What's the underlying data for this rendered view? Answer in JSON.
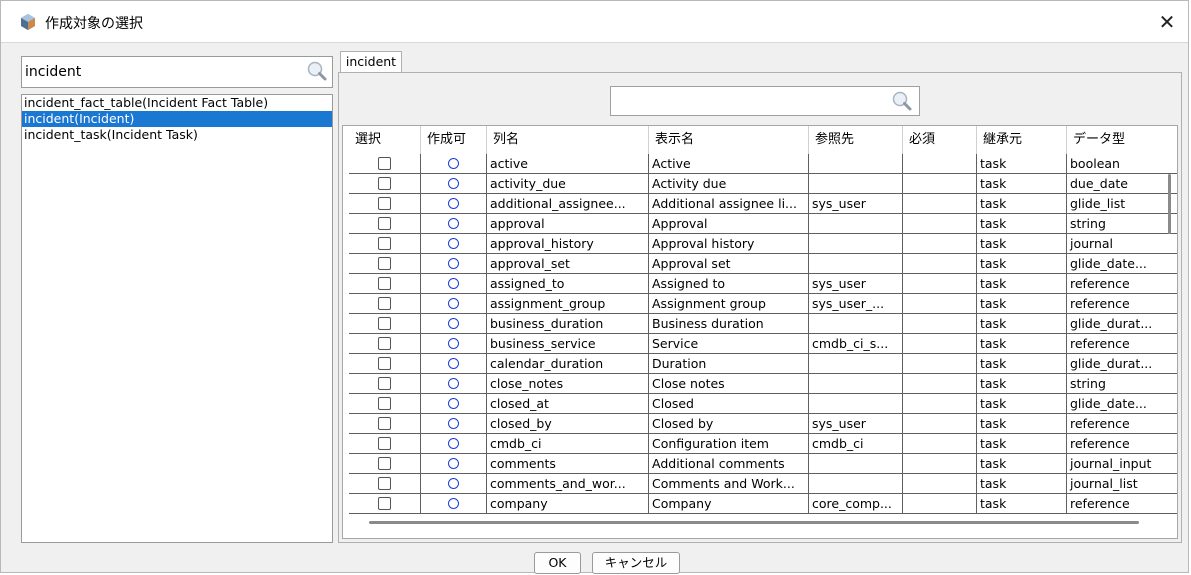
{
  "window": {
    "title": "作成対象の選択"
  },
  "left": {
    "search_value": "incident",
    "items": [
      {
        "label": "incident_fact_table(Incident Fact Table)",
        "selected": false
      },
      {
        "label": "incident(Incident)",
        "selected": true
      },
      {
        "label": "incident_task(Incident Task)",
        "selected": false
      }
    ]
  },
  "tab": {
    "label": "incident"
  },
  "filter": {
    "value": ""
  },
  "table": {
    "headers": [
      "選択",
      "作成可",
      "列名",
      "表示名",
      "参照先",
      "必須",
      "継承元",
      "データ型"
    ],
    "rows": [
      {
        "col": "active",
        "display": "Active",
        "ref": "",
        "inherit": "task",
        "type": "boolean"
      },
      {
        "col": "activity_due",
        "display": "Activity due",
        "ref": "",
        "inherit": "task",
        "type": "due_date"
      },
      {
        "col": "additional_assignee...",
        "display": "Additional assignee li...",
        "ref": "sys_user",
        "inherit": "task",
        "type": "glide_list"
      },
      {
        "col": "approval",
        "display": "Approval",
        "ref": "",
        "inherit": "task",
        "type": "string"
      },
      {
        "col": "approval_history",
        "display": "Approval history",
        "ref": "",
        "inherit": "task",
        "type": "journal"
      },
      {
        "col": "approval_set",
        "display": "Approval set",
        "ref": "",
        "inherit": "task",
        "type": "glide_date..."
      },
      {
        "col": "assigned_to",
        "display": "Assigned to",
        "ref": "sys_user",
        "inherit": "task",
        "type": "reference"
      },
      {
        "col": "assignment_group",
        "display": "Assignment group",
        "ref": "sys_user_...",
        "inherit": "task",
        "type": "reference"
      },
      {
        "col": "business_duration",
        "display": "Business duration",
        "ref": "",
        "inherit": "task",
        "type": "glide_durat..."
      },
      {
        "col": "business_service",
        "display": "Service",
        "ref": "cmdb_ci_s...",
        "inherit": "task",
        "type": "reference"
      },
      {
        "col": "calendar_duration",
        "display": "Duration",
        "ref": "",
        "inherit": "task",
        "type": "glide_durat..."
      },
      {
        "col": "close_notes",
        "display": "Close notes",
        "ref": "",
        "inherit": "task",
        "type": "string"
      },
      {
        "col": "closed_at",
        "display": "Closed",
        "ref": "",
        "inherit": "task",
        "type": "glide_date..."
      },
      {
        "col": "closed_by",
        "display": "Closed by",
        "ref": "sys_user",
        "inherit": "task",
        "type": "reference"
      },
      {
        "col": "cmdb_ci",
        "display": "Configuration item",
        "ref": "cmdb_ci",
        "inherit": "task",
        "type": "reference"
      },
      {
        "col": "comments",
        "display": "Additional comments",
        "ref": "",
        "inherit": "task",
        "type": "journal_input"
      },
      {
        "col": "comments_and_wor...",
        "display": "Comments and Work...",
        "ref": "",
        "inherit": "task",
        "type": "journal_list"
      },
      {
        "col": "company",
        "display": "Company",
        "ref": "core_comp...",
        "inherit": "task",
        "type": "reference"
      }
    ]
  },
  "buttons": {
    "ok": "OK",
    "cancel": "キャンセル"
  },
  "colors": {
    "selection": "#1a77d2",
    "circle": "#1c3fd6"
  }
}
